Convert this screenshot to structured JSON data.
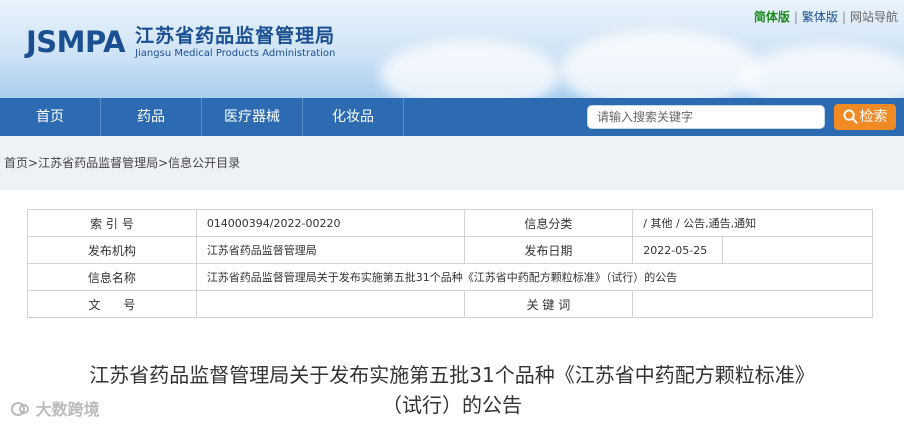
{
  "header": {
    "logo_abbr": "JSMPA",
    "logo_cn": "江苏省药品监督管理局",
    "logo_en": "Jiangsu Medical Products Administration",
    "links": {
      "simplified": "简体版",
      "traditional": "繁体版",
      "sitemap": "网站导航",
      "sep": "|"
    }
  },
  "nav": {
    "items": [
      "首页",
      "药品",
      "医疗器械",
      "化妆品"
    ],
    "search_placeholder": "请输入搜索关键字",
    "search_button": "检索"
  },
  "breadcrumb": {
    "home": "首页",
    "sep": ">",
    "org": "江苏省药品监督管理局",
    "section": "信息公开目录"
  },
  "meta": {
    "index_label": "索 引 号",
    "index_value": "014000394/2022-00220",
    "category_label": "信息分类",
    "category_value": "/  其他   /  公告,通告,通知",
    "publisher_label": "发布机构",
    "publisher_value": "江苏省药品监督管理局",
    "date_label": "发布日期",
    "date_value": "2022-05-25",
    "name_label": "信息名称",
    "name_value": "江苏省药品监督管理局关于发布实施第五批31个品种《江苏省中药配方颗粒标准》（试行）的公告",
    "docno_label": "文      号",
    "docno_value": "",
    "keywords_label": "关 键 词",
    "keywords_value": ""
  },
  "article": {
    "title_line1": "江苏省药品监督管理局关于发布实施第五批31个品种《江苏省中药配方颗粒标准》",
    "title_line2": "（试行）的公告"
  },
  "watermark": {
    "text": "大数跨境"
  }
}
